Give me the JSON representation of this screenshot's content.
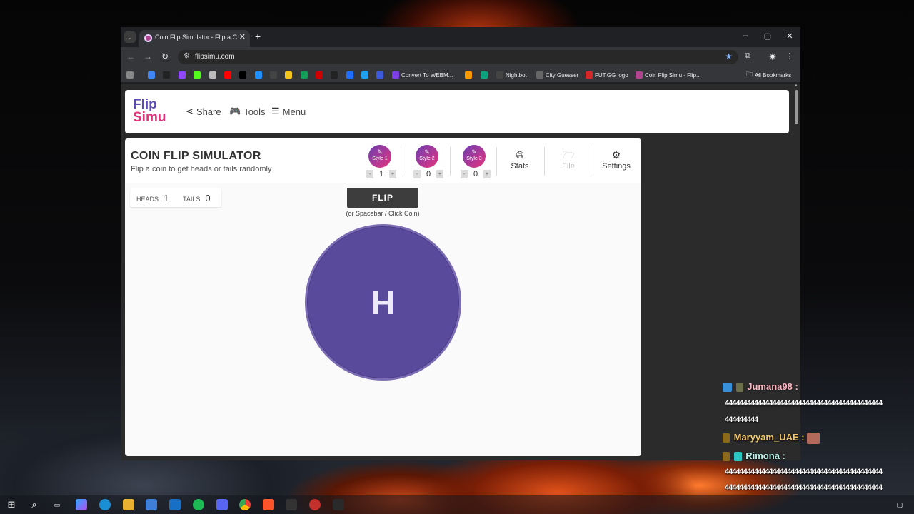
{
  "browser": {
    "tab_title": "Coin Flip Simulator - Flip a Coin",
    "tab_close": "✕",
    "new_tab": "+",
    "url": "flipsimu.com",
    "window_controls": {
      "minimize": "–",
      "maximize": "▢",
      "close": "✕"
    },
    "nav": {
      "back": "←",
      "forward": "→",
      "reload": "↻"
    },
    "bookmarks": [
      {
        "icon": "apps-grid-icon",
        "label": ""
      },
      {
        "icon": "google-icon",
        "label": ""
      },
      {
        "icon": "p-icon",
        "label": ""
      },
      {
        "icon": "twitch-icon",
        "label": ""
      },
      {
        "icon": "kick-icon",
        "label": ""
      },
      {
        "icon": "diamond-icon",
        "label": ""
      },
      {
        "icon": "youtube-icon",
        "label": ""
      },
      {
        "icon": "x-icon",
        "label": ""
      },
      {
        "icon": "pencil-icon",
        "label": ""
      },
      {
        "icon": "github-icon",
        "label": ""
      },
      {
        "icon": "yellow-box-icon",
        "label": ""
      },
      {
        "icon": "sheets-icon",
        "label": ""
      },
      {
        "icon": "red-icon",
        "label": ""
      },
      {
        "icon": "tv-icon",
        "label": ""
      },
      {
        "icon": "play-icon",
        "label": ""
      },
      {
        "icon": "s-icon",
        "label": ""
      },
      {
        "icon": "r-icon",
        "label": ""
      },
      {
        "icon": "convert-icon",
        "label": "Convert To WEBM..."
      },
      {
        "icon": "amazon-icon",
        "label": ""
      },
      {
        "icon": "chat-icon",
        "label": ""
      },
      {
        "icon": "nightbot-icon",
        "label": "Nightbot"
      },
      {
        "icon": "globe-icon",
        "label": "City Guesser"
      },
      {
        "icon": "futgg-icon",
        "label": "FUT.GG logo"
      },
      {
        "icon": "flipsimu-icon",
        "label": "Coin Flip Simu - Flip..."
      }
    ],
    "overflow": "»",
    "all_bookmarks": "All Bookmarks"
  },
  "site": {
    "logo_line1": "Flip",
    "logo_line2": "Simu",
    "nav": {
      "share": "Share",
      "tools": "Tools",
      "menu": "Menu"
    },
    "title": "COIN FLIP SIMULATOR",
    "subtitle": "Flip a coin to get heads or tails randomly",
    "styles": [
      {
        "label": "Style 1",
        "count": "1"
      },
      {
        "label": "Style 2",
        "count": "0"
      },
      {
        "label": "Style 3",
        "count": "0"
      }
    ],
    "stepper_minus": "-",
    "stepper_plus": "+",
    "tools": {
      "stats": "Stats",
      "file": "File",
      "settings": "Settings"
    },
    "counts": {
      "heads_label": "HEADS",
      "heads": "1",
      "tails_label": "TAILS",
      "tails": "0"
    },
    "flip_button": "FLIP",
    "flip_hint": "(or Spacebar / Click Coin)",
    "coin_face": "H",
    "colors": {
      "coin": "#5a4a9c",
      "brand_purple": "#5b4bb3",
      "brand_pink": "#e0357a"
    }
  },
  "chat": [
    {
      "user": "Jumana98 :",
      "color": "#ffb6c1",
      "message": "4444444444444444444444444444444444444444444"
    },
    {
      "user": "",
      "color": "#ffffff",
      "message": "444444444"
    },
    {
      "user": "Maryyam_UAE :",
      "color": "#f3c86a",
      "message": ""
    },
    {
      "user": "Rimona :",
      "color": "#b7f0e8",
      "message": ""
    },
    {
      "user": "",
      "color": "#ffffff",
      "message": "4444444444444444444444444444444444444444444"
    },
    {
      "user": "",
      "color": "#ffffff",
      "message": "4444444444444444444444444444444444444444444"
    }
  ]
}
